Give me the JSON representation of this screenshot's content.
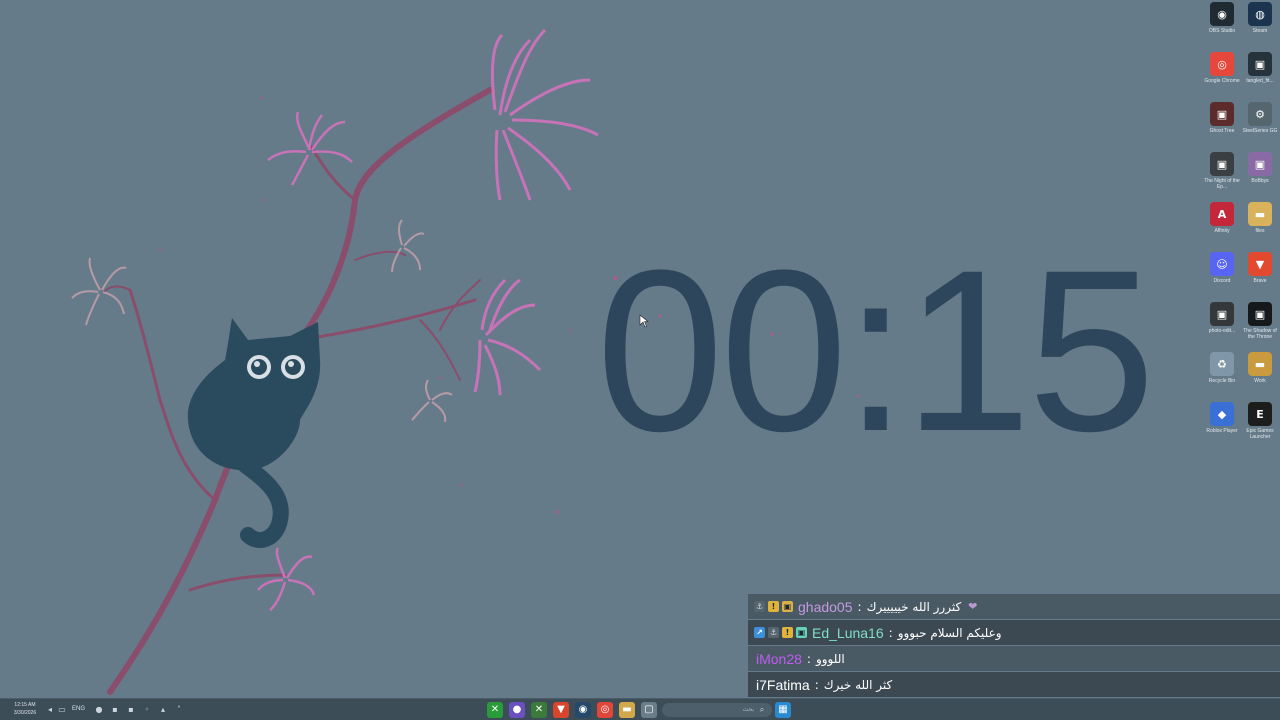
{
  "clock": {
    "time": "00:15"
  },
  "desktop_icons": [
    {
      "label": "OBS Studio",
      "icon": "obs-icon",
      "color": "#1f2a33"
    },
    {
      "label": "Steam",
      "icon": "steam-icon",
      "color": "#1b3550"
    },
    {
      "label": "Google Chrome",
      "icon": "chrome-icon",
      "color": "#e5483b"
    },
    {
      "label": "tangled_fit...",
      "icon": "game-thumbnail-icon",
      "color": "#26323c"
    },
    {
      "label": "Ghost Tree",
      "icon": "game-thumbnail-icon",
      "color": "#5c2b2b"
    },
    {
      "label": "SteelSeries GG",
      "icon": "steelseries-icon",
      "color": "#55666f"
    },
    {
      "label": "The Night of the Ep...",
      "icon": "game-thumbnail-icon",
      "color": "#3a3f44"
    },
    {
      "label": "BoBbys",
      "icon": "game-thumbnail-icon",
      "color": "#8a6aa5"
    },
    {
      "label": "Affinity",
      "icon": "affinity-icon",
      "color": "#c4263a"
    },
    {
      "label": "files",
      "icon": "folder-icon",
      "color": "#d8b35b"
    },
    {
      "label": "Discord",
      "icon": "discord-icon",
      "color": "#5865f2"
    },
    {
      "label": "Brave",
      "icon": "brave-icon",
      "color": "#e2492f"
    },
    {
      "label": "photo-edit...",
      "icon": "game-thumbnail-icon",
      "color": "#34383a"
    },
    {
      "label": "The Shadow of the Throne",
      "icon": "game-thumbnail-icon",
      "color": "#15191c"
    },
    {
      "label": "Recycle Bin",
      "icon": "recycle-bin-icon",
      "color": "#7f97a8"
    },
    {
      "label": "Work",
      "icon": "folder-icon",
      "color": "#c99a3e"
    },
    {
      "label": "Roblox Player",
      "icon": "roblox-icon",
      "color": "#3a6fd6"
    },
    {
      "label": "Epic Games Launcher",
      "icon": "epic-games-icon",
      "color": "#1d1d1d"
    }
  ],
  "chat": [
    {
      "username": "ghado05",
      "color": "#c59ae0",
      "message": "كثررر الله خيييييرك",
      "badges": [
        "sub-badge",
        "warning-badge",
        "gift-badge"
      ],
      "emote": "❤"
    },
    {
      "username": "Ed_Luna16",
      "color": "#7fe0c4",
      "message": "وعليكم السلام حبووو",
      "badges": [
        "prime-badge",
        "sub-badge",
        "warning-badge",
        "gift-badge"
      ],
      "emote": ""
    },
    {
      "username": "iMon28",
      "color": "#c05cf0",
      "message": "اللووو",
      "badges": [],
      "emote": ""
    },
    {
      "username": "i7Fatima",
      "color": "#ffffff",
      "message": "كثر الله خيرك",
      "badges": [],
      "emote": ""
    }
  ],
  "taskbar": {
    "time": "12:15 AM",
    "date": "3/30/2026",
    "language": "ENG",
    "search_placeholder": "بحث",
    "apps": [
      {
        "name": "xbox-icon",
        "color": "#2a9b3a"
      },
      {
        "name": "obs-app-icon",
        "color": "#6a4fc0"
      },
      {
        "name": "xbox-app-icon",
        "color": "#3a7a3a"
      },
      {
        "name": "brave-app-icon",
        "color": "#d8442c"
      },
      {
        "name": "steam-app-icon",
        "color": "#25496a"
      },
      {
        "name": "chrome-app-icon",
        "color": "#e0463a"
      },
      {
        "name": "file-explorer-icon",
        "color": "#d1a94a"
      },
      {
        "name": "window-app-icon",
        "color": "#6b7d88"
      }
    ],
    "pinned_right": {
      "name": "store-icon",
      "color": "#2a8ad0"
    }
  }
}
